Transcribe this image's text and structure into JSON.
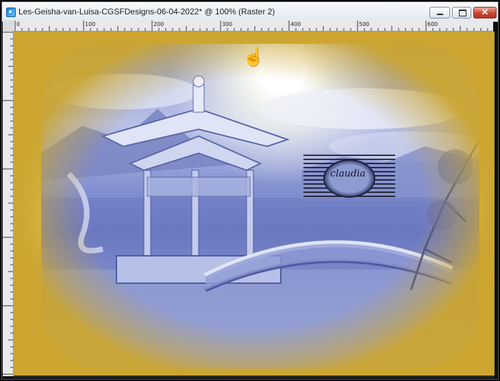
{
  "window": {
    "title": "Les-Geisha-van-Luisa-CGSFDesigns-06-04-2022* @ 100% (Raster 2)",
    "close_glyph": "✕"
  },
  "ruler": {
    "ticks": [
      "0",
      "100",
      "200",
      "300",
      "400",
      "500",
      "600"
    ]
  },
  "canvas": {
    "watermark": "claudia",
    "cursor_glyph": "☝"
  },
  "colors": {
    "frame_gold": "#c9a22e",
    "scene_blue": "#6675c0",
    "titlebar": "#e3e9f0"
  },
  "icons": {
    "app": "paint-shop-pro-icon",
    "minimize": "minimize-icon",
    "maximize": "maximize-icon",
    "close": "close-icon",
    "cursor": "pointing-hand-cursor-icon"
  }
}
